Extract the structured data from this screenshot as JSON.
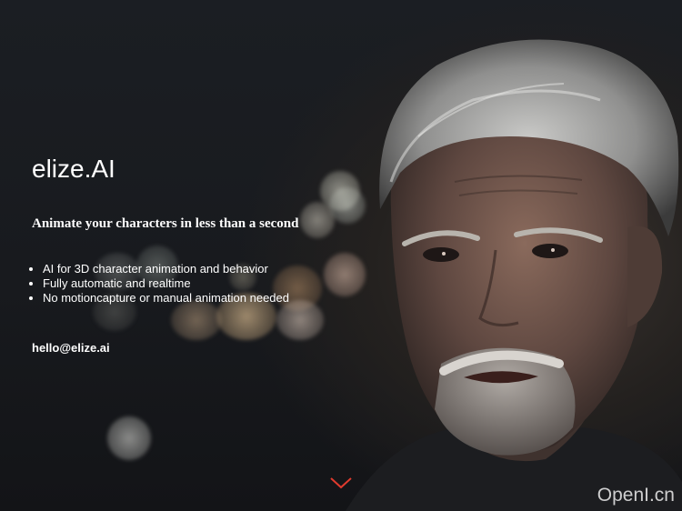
{
  "hero": {
    "brand": "elize.AI",
    "tagline": "Animate your characters in less than a second",
    "features": [
      "AI for 3D character animation and behavior",
      "Fully automatic and realtime",
      "No motioncapture or manual animation needed"
    ],
    "contact_email": "hello@elize.ai",
    "scroll_icon": "chevron-down-icon",
    "accent_color": "#e03b2e"
  },
  "watermark": "OpenI.cn"
}
